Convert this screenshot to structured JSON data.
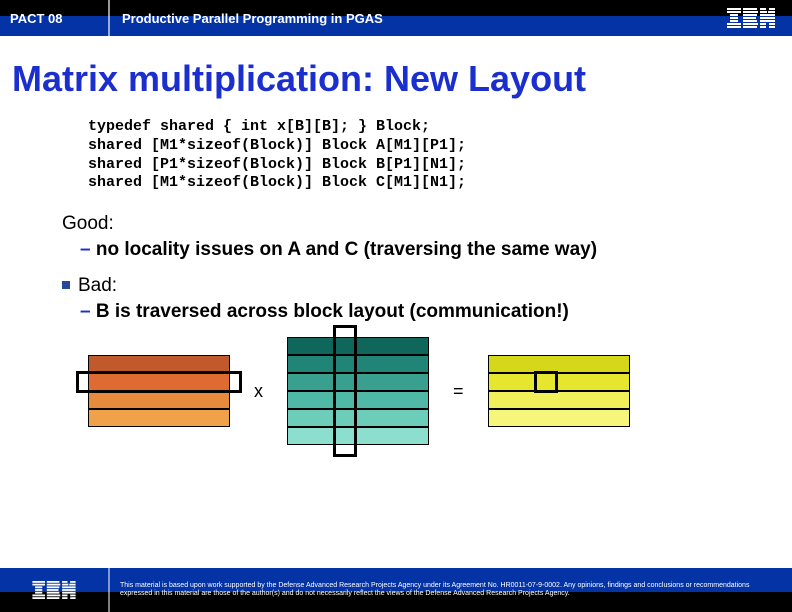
{
  "header": {
    "tag": "PACT 08",
    "subtitle": "Productive Parallel Programming in PGAS",
    "logo": "ibm-logo"
  },
  "title": "Matrix multiplication: New Layout",
  "code": "typedef shared { int x[B][B]; } Block;\nshared [M1*sizeof(Block)] Block A[M1][P1];\nshared [P1*sizeof(Block)] Block B[P1][N1];\nshared [M1*sizeof(Block)] Block C[M1][N1];",
  "good": {
    "label": "Good:",
    "point": "no locality issues on A and C (traversing the same way)"
  },
  "bad": {
    "label": "Bad:",
    "point": "B is traversed across block layout (communication!)"
  },
  "ops": {
    "times": "x",
    "equals": "="
  },
  "footer": {
    "disclaimer": "This material is based upon work supported by the Defense Advanced Research Projects Agency under its Agreement No. HR0011-07-9-0002. Any opinions, findings and conclusions or recommendations expressed in this material are those of the author(s) and do not necessarily reflect the views of the Defense Advanced Research Projects Agency."
  },
  "diagram": {
    "A": {
      "rows": 4,
      "overlay": "horizontal"
    },
    "B": {
      "rows": 6,
      "overlay": "vertical"
    },
    "C": {
      "rows": 4,
      "overlay": "square"
    }
  }
}
